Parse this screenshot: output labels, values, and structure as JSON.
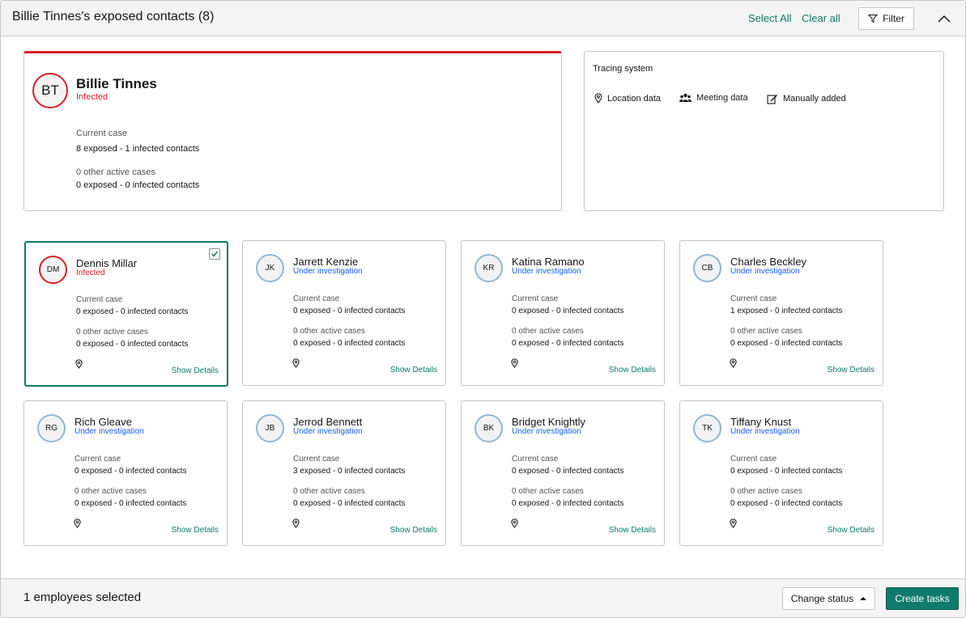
{
  "header": {
    "title": "Billie Tinnes's exposed contacts (8)",
    "select_all": "Select All",
    "clear_all": "Clear all",
    "filter_label": "Filter"
  },
  "main_person": {
    "initials": "BT",
    "name": "Billie Tinnes",
    "status": "Infected",
    "current_case_label": "Current case",
    "current_case_value": "8 exposed - 1 infected contacts",
    "other_cases_label": "0 other active cases",
    "other_cases_value": "0 exposed - 0 infected contacts"
  },
  "tracing": {
    "title": "Tracing system",
    "items": [
      {
        "label": "Location data",
        "icon": "location-pin-icon"
      },
      {
        "label": "Meeting data",
        "icon": "group-icon"
      },
      {
        "label": "Manually added",
        "icon": "edit-icon"
      }
    ]
  },
  "contact_labels": {
    "current_case": "Current case",
    "show_details": "Show Details"
  },
  "contacts": [
    {
      "initials": "DM",
      "name": "Dennis Millar",
      "status": "Infected",
      "current_case": "0 exposed - 0 infected contacts",
      "other_cases": "0 other active cases",
      "other_cases_value": "0 exposed - 0 infected contacts",
      "selected": true
    },
    {
      "initials": "JK",
      "name": "Jarrett Kenzie",
      "status": "Under investigation",
      "current_case": "0 exposed - 0 infected contacts",
      "other_cases": "0 other active cases",
      "other_cases_value": "0 exposed - 0 infected contacts",
      "selected": false
    },
    {
      "initials": "KR",
      "name": "Katina Ramano",
      "status": "Under investigation",
      "current_case": "0 exposed - 0 infected contacts",
      "other_cases": "0 other active cases",
      "other_cases_value": "0 exposed - 0 infected contacts",
      "selected": false
    },
    {
      "initials": "CB",
      "name": "Charles Beckley",
      "status": "Under investigation",
      "current_case": "1 exposed - 0 infected contacts",
      "other_cases": "0 other active cases",
      "other_cases_value": "0 exposed - 0 infected contacts",
      "selected": false
    },
    {
      "initials": "RG",
      "name": "Rich Gleave",
      "status": "Under investigation",
      "current_case": "0 exposed - 0 infected contacts",
      "other_cases": "0 other active cases",
      "other_cases_value": "0 exposed - 0 infected contacts",
      "selected": false
    },
    {
      "initials": "JB",
      "name": "Jerrod Bennett",
      "status": "Under investigation",
      "current_case": "3 exposed - 0 infected contacts",
      "other_cases": "0 other active cases",
      "other_cases_value": "0 exposed - 0 infected contacts",
      "selected": false
    },
    {
      "initials": "BK",
      "name": "Bridget Knightly",
      "status": "Under investigation",
      "current_case": "0 exposed - 0 infected contacts",
      "other_cases": "0 other active cases",
      "other_cases_value": "0 exposed - 0 infected contacts",
      "selected": false
    },
    {
      "initials": "TK",
      "name": "Tiffany Knust",
      "status": "Under investigation",
      "current_case": "0 exposed - 0 infected contacts",
      "other_cases": "0 other active cases",
      "other_cases_value": "0 exposed - 0 infected contacts",
      "selected": false
    }
  ],
  "footer": {
    "selection_text": "1 employees selected",
    "change_status_label": "Change status",
    "create_tasks_label": "Create tasks"
  },
  "colors": {
    "accent": "#0f7b6c",
    "infected": "#da1e28",
    "investigation": "#0f62fe"
  }
}
